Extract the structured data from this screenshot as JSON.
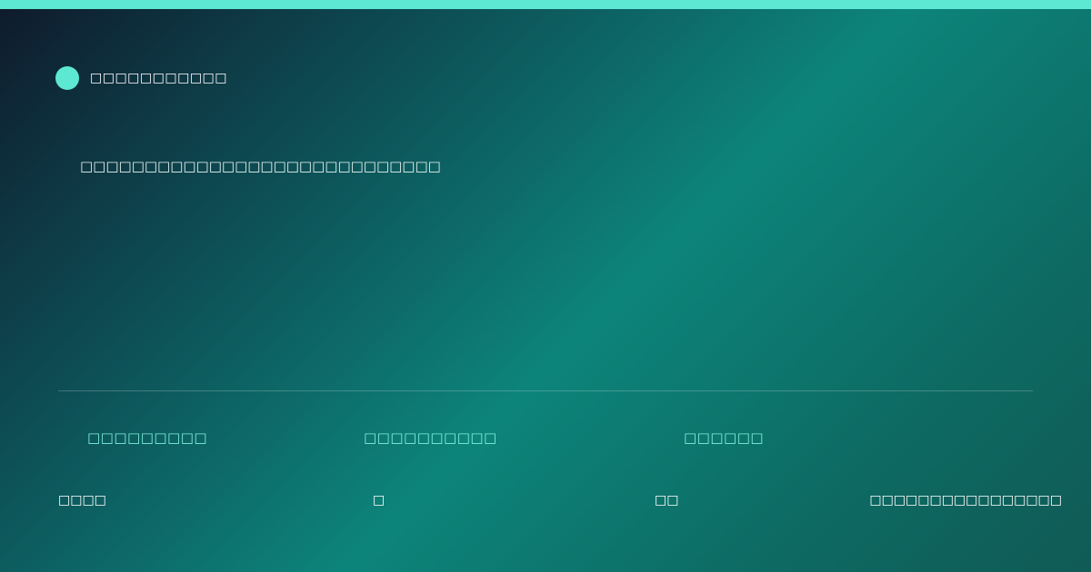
{
  "colors": {
    "accent": "#5de8d3",
    "label_text": "#7ff0de",
    "bg_dark": "#0f1a2c",
    "bg_teal": "#0d847a"
  },
  "brand": {
    "icon": "circle-logo-icon",
    "name": "□□□□□□□□□□□"
  },
  "headline": "□□□□□□□□□□□□□□□□□□□□□□□□□□□□",
  "stats": {
    "labels": [
      "□□□□□□□□□",
      "□□□□□□□□□□",
      "□□□□□□"
    ],
    "values": [
      "□□□□",
      "□",
      "□□",
      "□□□□□□□□□□□□□□□□"
    ]
  }
}
